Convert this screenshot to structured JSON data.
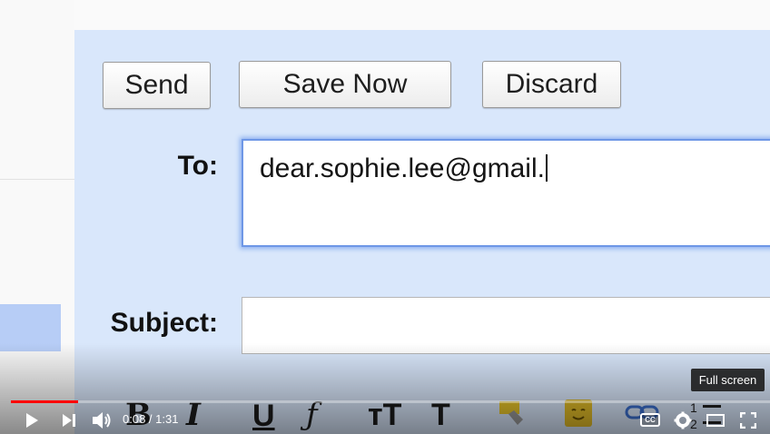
{
  "compose": {
    "send_label": "Send",
    "save_label": "Save Now",
    "discard_label": "Discard",
    "to_label": "To:",
    "to_value": "dear.sophie.lee@gmail.",
    "subject_label": "Subject:",
    "subject_value": ""
  },
  "toolbar": {
    "bold": "B",
    "italic": "I",
    "underline": "U",
    "font": "ƒ",
    "size": "тT",
    "text_color": "T"
  },
  "player": {
    "time_current": "0:08",
    "time_separator": " / ",
    "time_total": "1:31",
    "progress": 0.088,
    "tooltip": "Full screen",
    "cc_label": "CC",
    "accent_color": "#ff0000"
  }
}
